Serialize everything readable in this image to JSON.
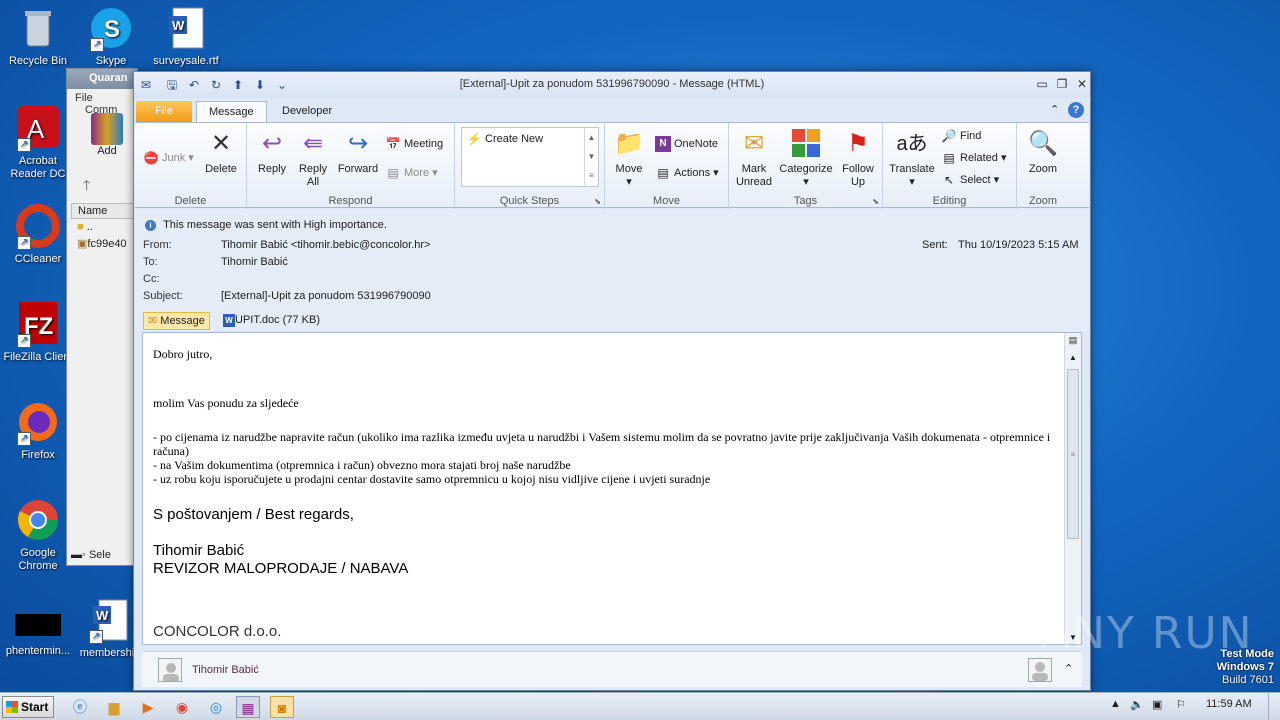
{
  "desktop": {
    "icons": [
      {
        "label": "Recycle Bin"
      },
      {
        "label": "Skype"
      },
      {
        "label": "surveysale.rtf"
      },
      {
        "label": "Acrobat Reader DC"
      },
      {
        "label": "CCleaner"
      },
      {
        "label": "FileZilla Client"
      },
      {
        "label": "Firefox"
      },
      {
        "label": "Google Chrome"
      },
      {
        "label": "phentermin..."
      },
      {
        "label": "membership"
      }
    ]
  },
  "winrar": {
    "title": "Quaran",
    "menu_file": "File",
    "menu_comm": "Comm",
    "add_label": "Add",
    "col_name": "Name",
    "row_up": "..",
    "row_file": "fc99e40",
    "status": "Sele"
  },
  "window": {
    "title": "[External]-Upit za ponudom 531996790090 - Message (HTML)"
  },
  "tabs": {
    "file": "File",
    "message": "Message",
    "developer": "Developer"
  },
  "ribbon": {
    "junk": "Junk",
    "delete": "Delete",
    "group_delete": "Delete",
    "reply": "Reply",
    "reply_all": "Reply All",
    "forward": "Forward",
    "meeting": "Meeting",
    "more": "More",
    "group_respond": "Respond",
    "create_new": "Create New",
    "group_quicksteps": "Quick Steps",
    "move": "Move",
    "onenote": "OneNote",
    "actions": "Actions",
    "group_move": "Move",
    "mark_unread": "Mark Unread",
    "categorize": "Categorize",
    "follow_up": "Follow Up",
    "group_tags": "Tags",
    "translate": "Translate",
    "find": "Find",
    "related": "Related",
    "select": "Select",
    "group_editing": "Editing",
    "zoom": "Zoom",
    "group_zoom": "Zoom"
  },
  "header": {
    "importance": "This message was sent with High importance.",
    "from_label": "From:",
    "from": "Tihomir Babić <tihomir.bebic@concolor.hr>",
    "sent_label": "Sent:",
    "sent": "Thu 10/19/2023 5:15 AM",
    "to_label": "To:",
    "to": "Tihomir Babić",
    "cc_label": "Cc:",
    "cc": "",
    "subject_label": "Subject:",
    "subject": "[External]-Upit za ponudom 531996790090"
  },
  "attachments": {
    "message": "Message",
    "file": "UPIT.doc (77 KB)"
  },
  "body": {
    "greeting": "Dobro jutro,",
    "line1": "molim Vas ponudu za sljedeće",
    "line2": "- po cijenama iz narudžbe napravite račun (ukoliko ima razlika između uvjeta u narudžbi i Vašem sistemu molim da se povratno javite prije zaključivanja Vaših dokumenata - otpremnice i računa)",
    "line3": "- na Vašim dokumentima (otpremnica i račun) obvezno mora stajati broj naše narudžbe",
    "line4": "- uz robu koju isporučujete u prodajni centar dostavite samo otpremnicu u kojoj nisu vidljive cijene i uvjeti suradnje",
    "regards": "S poštovanjem / Best regards,",
    "sig_name": "Tihomir Babić",
    "sig_title": "REVIZOR MALOPRODAJE / NABAVA",
    "sig_company": "CONCOLOR d.o.o."
  },
  "people_pane": {
    "name": "Tihomir Babić"
  },
  "taskbar": {
    "start": "Start",
    "time": "11:59 AM"
  },
  "watermark": {
    "line1": "Test Mode",
    "line2": "Windows 7",
    "line3": "Build 7601",
    "brand": "ANY RUN"
  }
}
